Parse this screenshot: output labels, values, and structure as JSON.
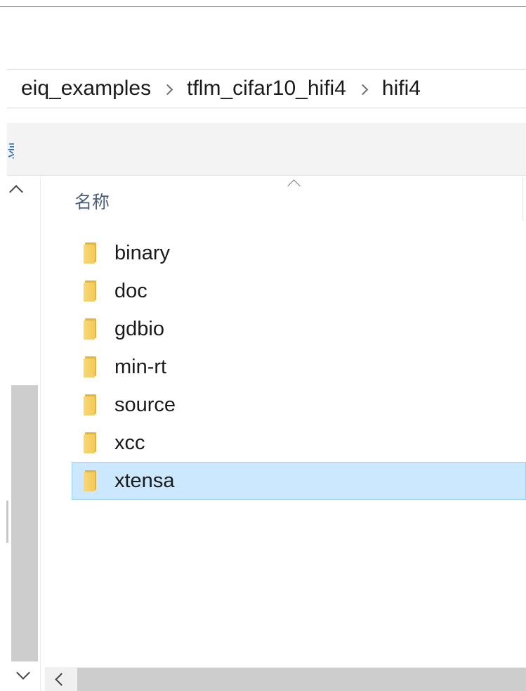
{
  "breadcrumb": {
    "items": [
      "eiq_examples",
      "tflm_cifar10_hifi4",
      "hifi4"
    ]
  },
  "toolbar": {
    "fragment": "录"
  },
  "columns": {
    "name_header": "名称"
  },
  "files": [
    {
      "name": "binary",
      "type": "folder",
      "selected": false
    },
    {
      "name": "doc",
      "type": "folder",
      "selected": false
    },
    {
      "name": "gdbio",
      "type": "folder",
      "selected": false
    },
    {
      "name": "min-rt",
      "type": "folder",
      "selected": false
    },
    {
      "name": "source",
      "type": "folder",
      "selected": false
    },
    {
      "name": "xcc",
      "type": "folder",
      "selected": false
    },
    {
      "name": "xtensa",
      "type": "folder",
      "selected": true
    }
  ],
  "colors": {
    "selection_bg": "#cce8ff",
    "selection_border": "#99d1ff",
    "folder_yellow": "#f3cb5a",
    "header_text": "#4c607a"
  },
  "icons": {
    "folder": "folder-icon",
    "breadcrumb_separator": "chevron-right-icon",
    "sort": "sort-ascending-icon",
    "scroll_up": "chevron-up-icon",
    "scroll_down": "chevron-down-icon",
    "scroll_left": "chevron-left-icon"
  }
}
